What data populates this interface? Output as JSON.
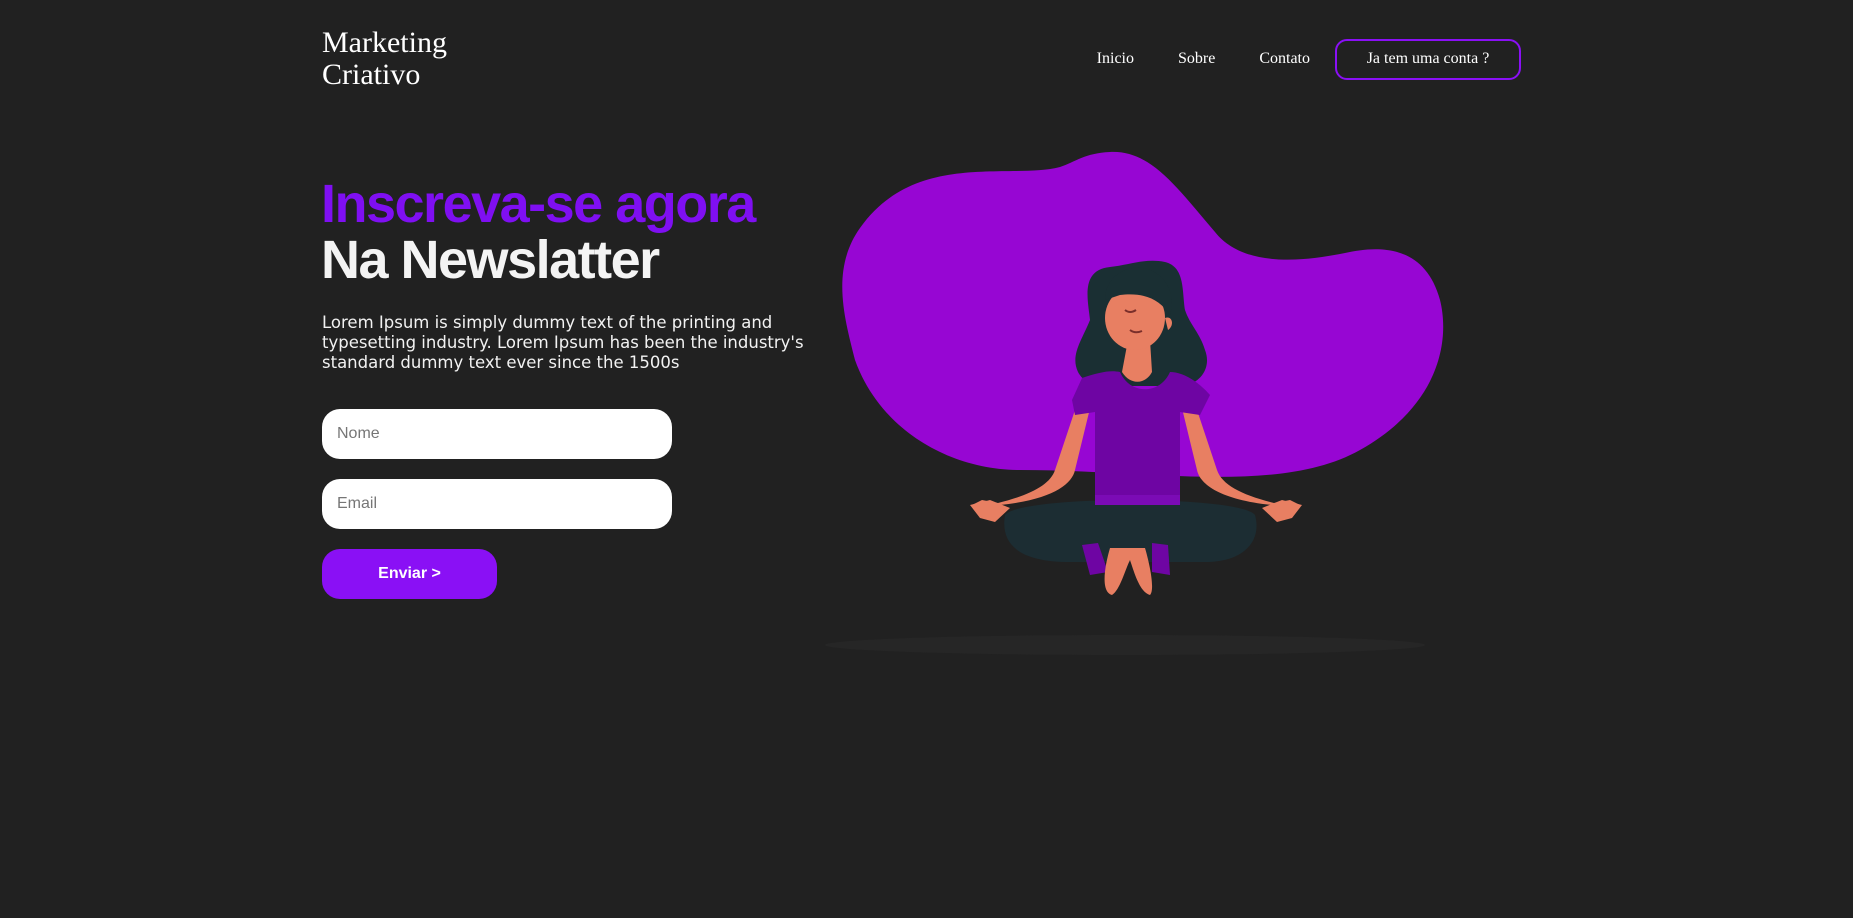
{
  "header": {
    "logo_line1": "Marketing",
    "logo_line2": "Criativo",
    "nav": [
      "Inicio",
      "Sobre",
      "Contato"
    ],
    "login_label": "Ja tem uma conta ?"
  },
  "hero": {
    "title_line1": "Inscreva-se agora",
    "title_line2": "Na Newslatter",
    "description": "Lorem Ipsum is simply dummy text of the printing and typesetting industry. Lorem Ipsum has been the industry's standard dummy text ever since the 1500s"
  },
  "form": {
    "name_placeholder": "Nome",
    "email_placeholder": "Email",
    "submit_label": "Enviar >"
  },
  "colors": {
    "background": "#212121",
    "accent": "#8a10f5",
    "blob": "#9706d3",
    "skin": "#e87f62",
    "hair": "#1a2f33",
    "shirt": "#6e05a3"
  },
  "icons": {
    "illustration": "meditating-woman-illustration"
  }
}
